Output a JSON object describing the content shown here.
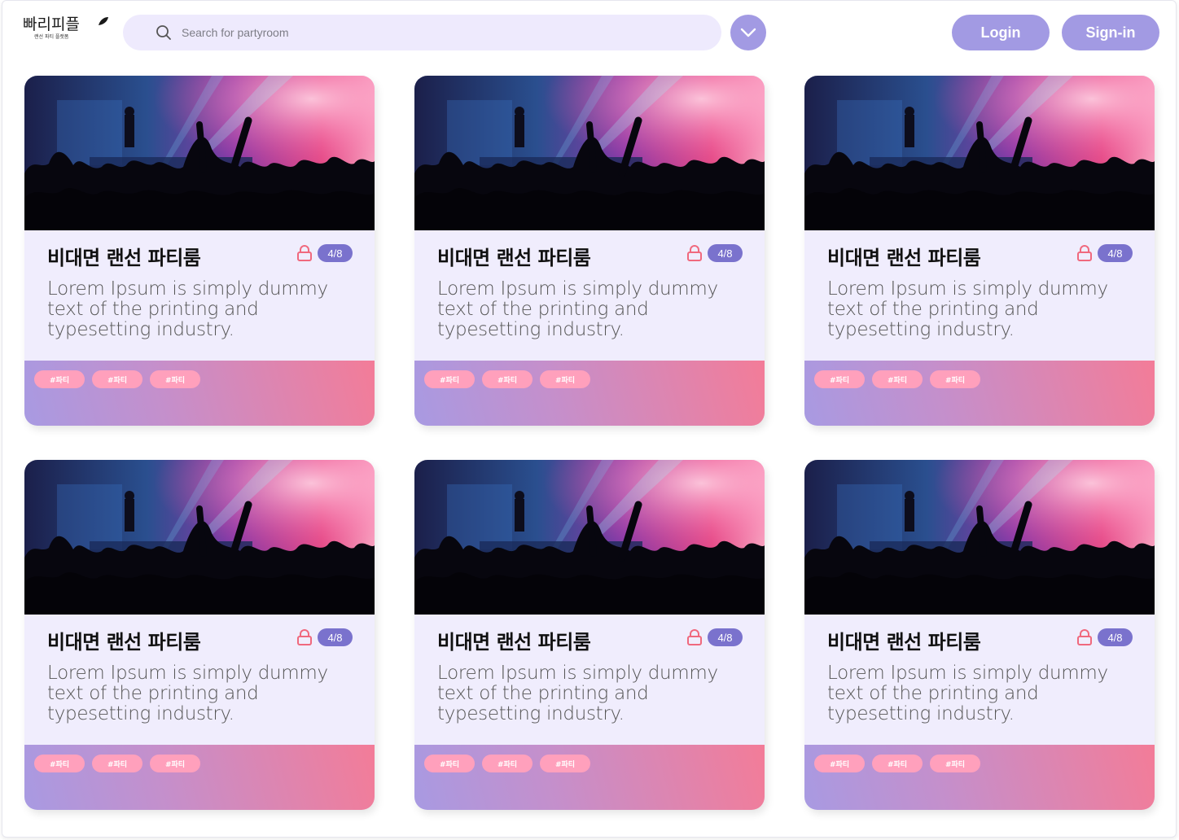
{
  "header": {
    "logo_text": "빠리피플",
    "logo_tagline": "랜선 파티 플랫폼",
    "search_placeholder": "Search for partyroom",
    "login_label": "Login",
    "signin_label": "Sign-in"
  },
  "icons": {
    "search": "search-icon",
    "dropdown": "chevron-down-icon",
    "lock": "lock-icon",
    "leaf": "leaf-icon"
  },
  "colors": {
    "accent": "#a29ae3",
    "search_bg": "#eeeafd",
    "card_bg": "#f0edfd",
    "badge": "#7a72cd",
    "lock": "#f0697e",
    "tag": "#ffa0bc",
    "gradient_start": "#a89ae2",
    "gradient_end": "#f37c98"
  },
  "cards": [
    {
      "title": "비대면 랜선 파티룸",
      "count": "4/8",
      "description": "Lorem Ipsum is simply dummy text of the printing and typesetting industry.",
      "tags": [
        "#파티",
        "#파티",
        "#파티"
      ]
    },
    {
      "title": "비대면 랜선 파티룸",
      "count": "4/8",
      "description": "Lorem Ipsum is simply dummy text of the printing and typesetting industry.",
      "tags": [
        "#파티",
        "#파티",
        "#파티"
      ]
    },
    {
      "title": "비대면 랜선 파티룸",
      "count": "4/8",
      "description": "Lorem Ipsum is simply dummy text of the printing and typesetting industry.",
      "tags": [
        "#파티",
        "#파티",
        "#파티"
      ]
    },
    {
      "title": "비대면 랜선 파티룸",
      "count": "4/8",
      "description": "Lorem Ipsum is simply dummy text of the printing and typesetting industry.",
      "tags": [
        "#파티",
        "#파티",
        "#파티"
      ]
    },
    {
      "title": "비대면 랜선 파티룸",
      "count": "4/8",
      "description": "Lorem Ipsum is simply dummy text of the printing and typesetting industry.",
      "tags": [
        "#파티",
        "#파티",
        "#파티"
      ]
    },
    {
      "title": "비대면 랜선 파티룸",
      "count": "4/8",
      "description": "Lorem Ipsum is simply dummy text of the printing and typesetting industry.",
      "tags": [
        "#파티",
        "#파티",
        "#파티"
      ]
    }
  ]
}
